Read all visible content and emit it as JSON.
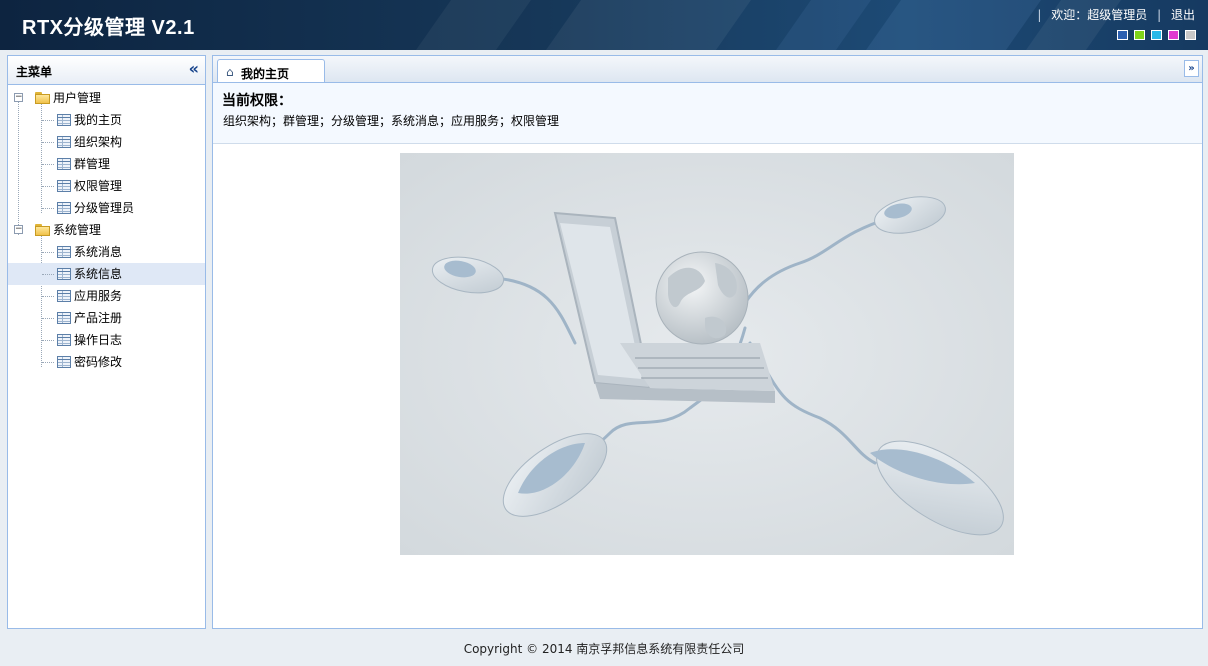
{
  "header": {
    "title": "RTX分级管理  V2.1",
    "welcome": "欢迎：超级管理员",
    "logout": "退出",
    "separator": "|",
    "theme_colors": [
      "#2b5fb0",
      "#7fd319",
      "#28b8e8",
      "#e03ad0",
      "#c8c8c8"
    ]
  },
  "sidebar": {
    "title": "主菜单",
    "collapse_icon": "double-chevron-left-icon",
    "groups": [
      {
        "label": "用户管理",
        "expander": "⊟",
        "items": [
          "我的主页",
          "组织架构",
          "群管理",
          "权限管理",
          "分级管理员"
        ]
      },
      {
        "label": "系统管理",
        "expander": "⊟",
        "items": [
          "系统消息",
          "系统信息",
          "应用服务",
          "产品注册",
          "操作日志",
          "密码修改"
        ]
      }
    ],
    "selected_item": "系统信息"
  },
  "tabs": [
    {
      "label": "我的主页",
      "icon": "home-icon"
    }
  ],
  "tab_menu_icon": "double-chevron-down-icon",
  "permissions": {
    "title": "当前权限：",
    "list": "组织架构；群管理；分级管理；系统消息；应用服务；权限管理"
  },
  "hero_image": "laptop-globe-mice-illustration",
  "footer": {
    "copyright": "Copyright © 2014 南京孚邦信息系统有限责任公司"
  }
}
